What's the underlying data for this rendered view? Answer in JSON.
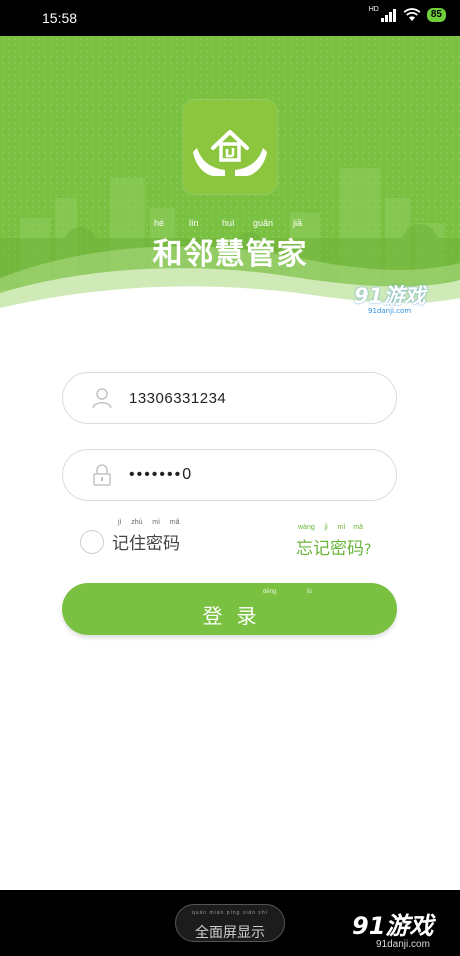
{
  "status_bar": {
    "time": "15:58",
    "network": "HD",
    "battery": "85",
    "icons": [
      "signal-icon",
      "wifi-icon",
      "battery-icon"
    ]
  },
  "header": {
    "app_name": "和邻慧管家",
    "app_name_pinyin": [
      "hé",
      "lín",
      "huì",
      "guǎn",
      "jiā"
    ],
    "logo": "house-hands-logo",
    "watermark": {
      "brand": "91游戏",
      "domain": "91danji.com"
    }
  },
  "login_form": {
    "username": {
      "value": "13306331234",
      "icon": "user-icon"
    },
    "password": {
      "value": "•••••••0",
      "icon": "lock-icon"
    },
    "remember": {
      "label": "记住密码",
      "pinyin": [
        "jì",
        "zhù",
        "mì",
        "mǎ"
      ]
    },
    "forgot": {
      "label": "忘记密码",
      "suffix": "?",
      "pinyin": [
        "wàng",
        "jì",
        "mì",
        "mǎ"
      ]
    },
    "login_button": {
      "label": "登录",
      "pinyin": [
        "dēng",
        "lù"
      ]
    }
  },
  "bottom_bar": {
    "fullscreen_label": "全面屏显示",
    "fullscreen_pinyin": "quán miàn píng xiǎn shì",
    "watermark": {
      "brand": "91游戏",
      "domain": "91danji.com"
    }
  },
  "colors": {
    "brand_green": "#7ac142",
    "link_green": "#6bb43a",
    "status_bar": "#000000"
  }
}
